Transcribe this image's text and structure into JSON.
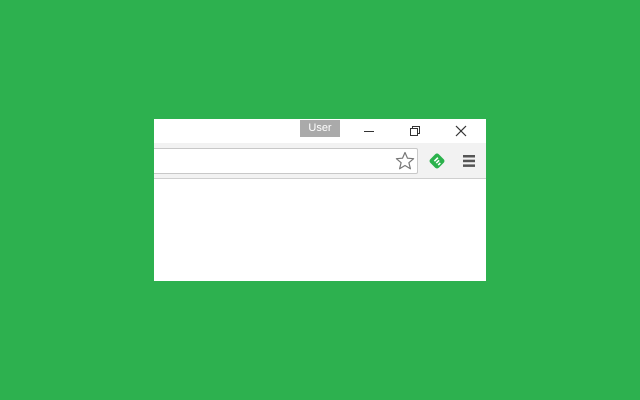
{
  "titlebar": {
    "user_label": "User"
  },
  "icons": {
    "minimize": "minimize-icon",
    "restore": "restore-icon",
    "close": "close-icon",
    "bookmark": "star-icon",
    "extension": "feedly-extension-icon",
    "menu": "hamburger-menu-icon"
  },
  "colors": {
    "desktop_background": "#2db14f",
    "extension_green": "#2bb24c",
    "user_badge": "#aaaaaa"
  }
}
